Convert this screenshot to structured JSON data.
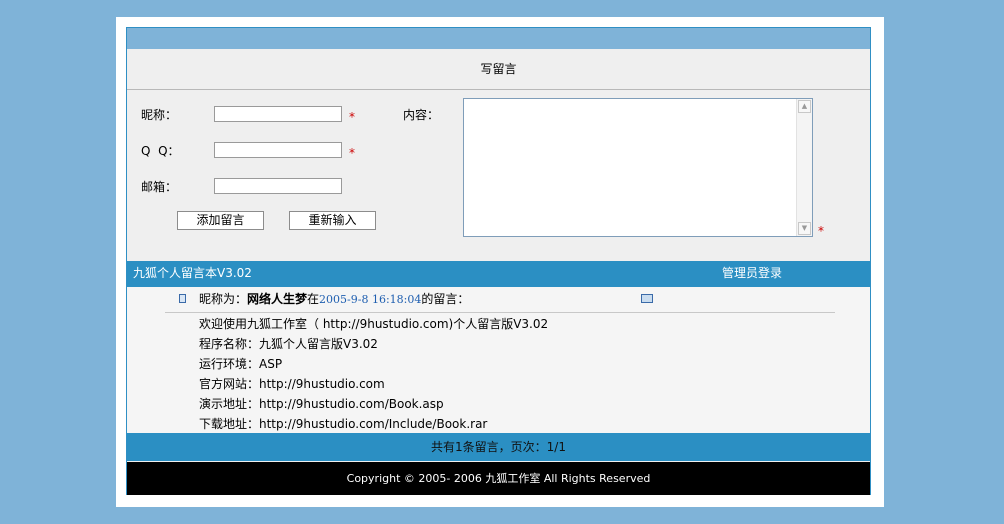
{
  "form": {
    "title": "写留言",
    "nickname_label": "昵称：",
    "qq_label": "Q  Q：",
    "email_label": "邮箱：",
    "content_label": "内容：",
    "required_mark": "*",
    "add_button": "添加留言",
    "reset_button": "重新输入",
    "nickname_value": "",
    "qq_value": "",
    "email_value": "",
    "content_value": ""
  },
  "header_bar": {
    "book_name": "九狐个人留言本V3.02",
    "admin_login": "管理员登录"
  },
  "message": {
    "prefix": "昵称为：",
    "author": "网络人生梦",
    "in": "在",
    "time": "2005-9-8 16:18:04",
    "suffix": "的留言：",
    "lines": [
      "欢迎使用九狐工作室（ http://9hustudio.com)个人留言版V3.02",
      "程序名称：九狐个人留言版V3.02",
      "运行环境：ASP",
      "官方网站：http://9hustudio.com",
      "演示地址：http://9hustudio.com/Book.asp",
      "下载地址：http://9hustudio.com/Include/Book.rar"
    ]
  },
  "pagination": {
    "text": "共有1条留言，页次：1/1"
  },
  "footer": {
    "text": "Copyright © 2005- 2006 九狐工作室 All Rights Reserved"
  },
  "colors": {
    "accent": "#2b8fc3",
    "background": "#7fb3d8",
    "time": "#1f5fb0",
    "required": "#cc0000"
  }
}
